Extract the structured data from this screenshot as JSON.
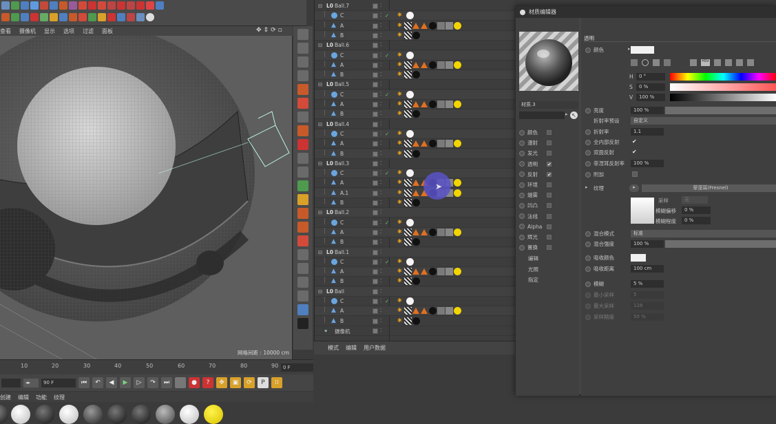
{
  "viewport": {
    "menu": [
      "查看",
      "摄像机",
      "显示",
      "选项",
      "过滤",
      "面板"
    ],
    "status": "网格间距 : 10000 cm",
    "nav_icons": [
      "move-icon",
      "zoom-icon",
      "rotate-icon",
      "maximize-icon"
    ]
  },
  "timeline": {
    "ticks": [
      "10",
      "20",
      "30",
      "40",
      "50",
      "60",
      "70",
      "80",
      "90"
    ],
    "current_frame": "0 F",
    "end_frame": "90 F"
  },
  "material_manager": {
    "menu": [
      "创建",
      "编辑",
      "功能",
      "纹理"
    ]
  },
  "object_manager": {
    "objects": [
      {
        "name": "Ball.7",
        "children": [
          "C",
          "A",
          "B"
        ]
      },
      {
        "name": "Ball.6",
        "children": [
          "C",
          "A",
          "B"
        ]
      },
      {
        "name": "Ball.5",
        "children": [
          "C",
          "A",
          "B"
        ]
      },
      {
        "name": "Ball.4",
        "children": [
          "C",
          "A",
          "B"
        ]
      },
      {
        "name": "Ball.3",
        "children": [
          "C",
          "A",
          "A.1",
          "B"
        ]
      },
      {
        "name": "Ball.2",
        "children": [
          "C",
          "A",
          "B"
        ]
      },
      {
        "name": "Ball.1",
        "children": [
          "C",
          "A",
          "B"
        ]
      },
      {
        "name": "Ball",
        "children": [
          "C",
          "A",
          "B"
        ]
      }
    ],
    "last_item": "摄像机",
    "bottom_tabs": [
      "模式",
      "编辑",
      "用户数据"
    ]
  },
  "material_editor": {
    "title": "材质编辑器",
    "material_name": "材质.3",
    "channels": [
      {
        "label": "颜色",
        "checked": false
      },
      {
        "label": "漫射",
        "checked": false
      },
      {
        "label": "发光",
        "checked": false
      },
      {
        "label": "透明",
        "checked": true
      },
      {
        "label": "反射",
        "checked": true
      },
      {
        "label": "环境",
        "checked": false
      },
      {
        "label": "烟雾",
        "checked": false
      },
      {
        "label": "凹凸",
        "checked": false
      },
      {
        "label": "法线",
        "checked": false
      },
      {
        "label": "Alpha",
        "checked": false
      },
      {
        "label": "辉光",
        "checked": false
      },
      {
        "label": "置换",
        "checked": false
      }
    ],
    "extra_items": [
      "编辑",
      "光照",
      "指定"
    ],
    "section_title": "透明",
    "color_label": "颜色",
    "hsv": {
      "h_label": "H",
      "h_value": "0 °",
      "s_label": "S",
      "s_value": "0 %",
      "v_label": "V",
      "v_value": "100 %"
    },
    "brightness": {
      "label": "亮度",
      "value": "100 %",
      "fraction": 1.0
    },
    "refraction_preset": {
      "label": "折射率预设",
      "value": "自定义"
    },
    "refraction": {
      "label": "折射率",
      "value": "1.1"
    },
    "total_internal_reflection": {
      "label": "全内部反射",
      "checked": true
    },
    "double_reflection": {
      "label": "双面反射",
      "checked": true
    },
    "fresnel_reflectivity": {
      "label": "菲涅耳反射率",
      "value": "100 %"
    },
    "additive": {
      "label": "附加",
      "checked": false
    },
    "texture": {
      "label": "纹理",
      "value": "菲涅耳(Fresnel)"
    },
    "sampling": {
      "label": "采样",
      "value": "无"
    },
    "blur_offset": {
      "label": "模糊偏移",
      "value": "0 %"
    },
    "blur_scale": {
      "label": "模糊程度",
      "value": "0 %"
    },
    "mix_mode": {
      "label": "混合模式",
      "value": "标准"
    },
    "mix_strength": {
      "label": "混合强度",
      "value": "100 %",
      "fraction": 1.0
    },
    "absorption_color": {
      "label": "吸收颜色"
    },
    "absorption_distance": {
      "label": "吸收距离",
      "value": "100 cm"
    },
    "blurriness": {
      "label": "模糊",
      "value": "5 %"
    },
    "min_samples": {
      "label": "最小采样",
      "value": "5"
    },
    "max_samples": {
      "label": "最大采样",
      "value": "128"
    },
    "sample_accuracy": {
      "label": "采样精度",
      "value": "50 %"
    }
  },
  "colors": {
    "accent_orange": "#e2701f",
    "tag_yellow": "#f2d400",
    "cursor_highlight": "#5b53c9"
  }
}
